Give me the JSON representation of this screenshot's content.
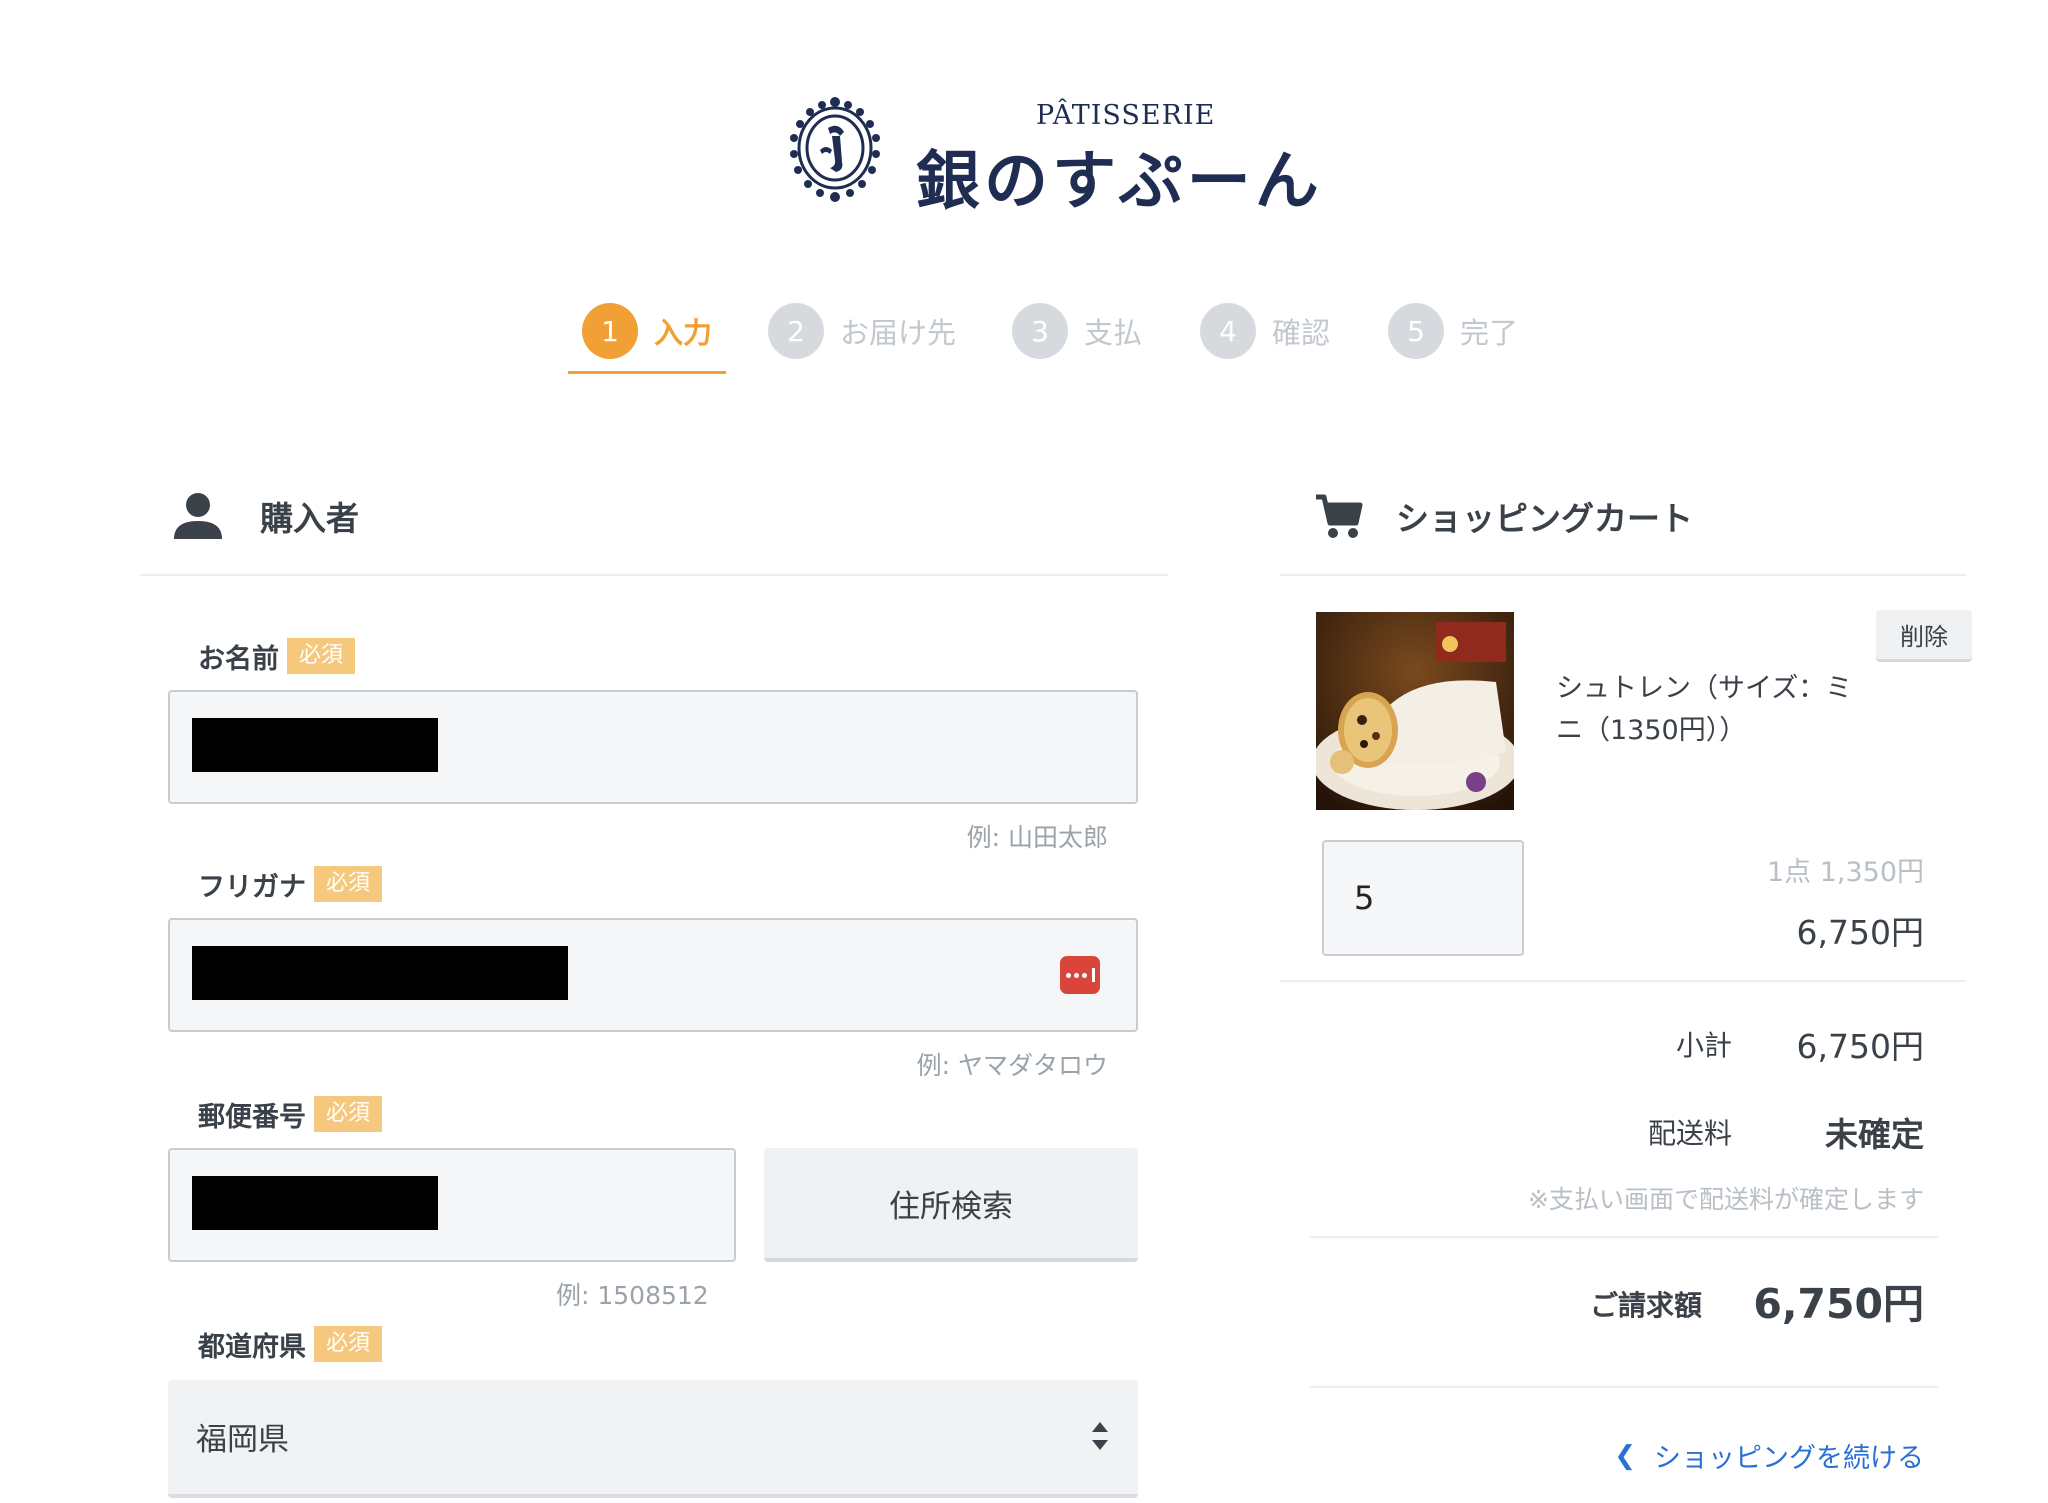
{
  "logo": {
    "sub": "PÂTISSERIE",
    "main": "銀のすぷーん"
  },
  "steps": [
    {
      "num": "1",
      "label": "入力",
      "active": true
    },
    {
      "num": "2",
      "label": "お届け先",
      "active": false
    },
    {
      "num": "3",
      "label": "支払",
      "active": false
    },
    {
      "num": "4",
      "label": "確認",
      "active": false
    },
    {
      "num": "5",
      "label": "完了",
      "active": false
    }
  ],
  "purchaser": {
    "title": "購入者",
    "icon": "person-icon",
    "required_badge": "必須",
    "name": {
      "label": "お名前",
      "hint": "例: 山田太郎"
    },
    "furigana": {
      "label": "フリガナ",
      "hint": "例: ヤマダタロウ"
    },
    "postal": {
      "label": "郵便番号",
      "hint": "例: 1508512",
      "search_button": "住所検索"
    },
    "prefecture": {
      "label": "都道府県",
      "value": "福岡県"
    }
  },
  "cart": {
    "title": "ショッピングカート",
    "icon": "cart-icon",
    "item": {
      "name": "シュトレン（サイズ：ミニ（1350円））",
      "delete_label": "削除",
      "quantity": "5",
      "unit_price": "1点 1,350円",
      "line_total": "6,750円"
    },
    "subtotal_label": "小計",
    "subtotal_value": "6,750円",
    "shipping_label": "配送料",
    "shipping_value": "未確定",
    "shipping_note": "※支払い画面で配送料が確定します",
    "total_label": "ご請求額",
    "total_value": "6,750円",
    "continue_label": "ショッピングを続ける"
  },
  "colors": {
    "accent": "#f0a035",
    "badge": "#f6c87e",
    "link": "#2a6fd6",
    "brand": "#1f2d52"
  }
}
